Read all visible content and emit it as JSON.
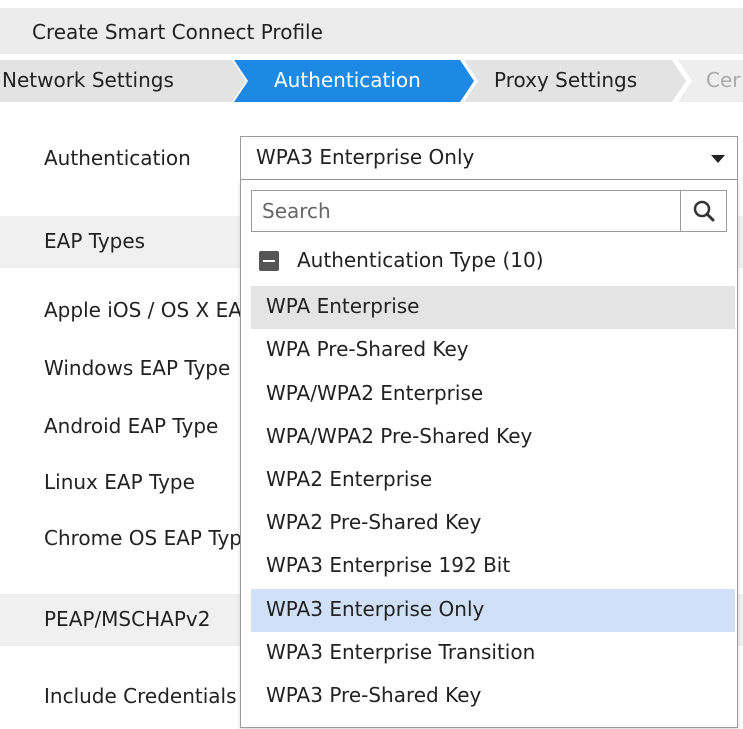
{
  "header": {
    "title": "Create Smart Connect Profile"
  },
  "wizard": {
    "steps": [
      {
        "label": "Network Settings",
        "state": "done"
      },
      {
        "label": "Authentication",
        "state": "active"
      },
      {
        "label": "Proxy Settings",
        "state": "pending"
      },
      {
        "label": "Cer",
        "state": "pending"
      }
    ],
    "colors": {
      "active": "#1e88e5",
      "inactive": "#e3e3e3"
    }
  },
  "form": {
    "authentication_label": "Authentication",
    "authentication_value": "WPA3 Enterprise Only",
    "eap_types_header": "EAP Types",
    "rows": [
      "Apple iOS / OS X EAP Type",
      "Windows EAP Type",
      "Android EAP Type",
      "Linux EAP Type",
      "Chrome OS EAP Type"
    ],
    "peap_header": "PEAP/MSCHAPv2",
    "include_credentials": "Include Credentials"
  },
  "dropdown": {
    "search_placeholder": "Search",
    "group_label": "Authentication Type",
    "group_count": "(10)",
    "options": [
      "WPA Enterprise",
      "WPA Pre-Shared Key",
      "WPA/WPA2 Enterprise",
      "WPA/WPA2 Pre-Shared Key",
      "WPA2 Enterprise",
      "WPA2 Pre-Shared Key",
      "WPA3 Enterprise 192 Bit",
      "WPA3 Enterprise Only",
      "WPA3 Enterprise Transition",
      "WPA3 Pre-Shared Key"
    ],
    "hovered": "WPA Enterprise",
    "selected": "WPA3 Enterprise Only",
    "colors": {
      "hover": "#e4e4e4",
      "selected": "#cfe0f7"
    }
  }
}
